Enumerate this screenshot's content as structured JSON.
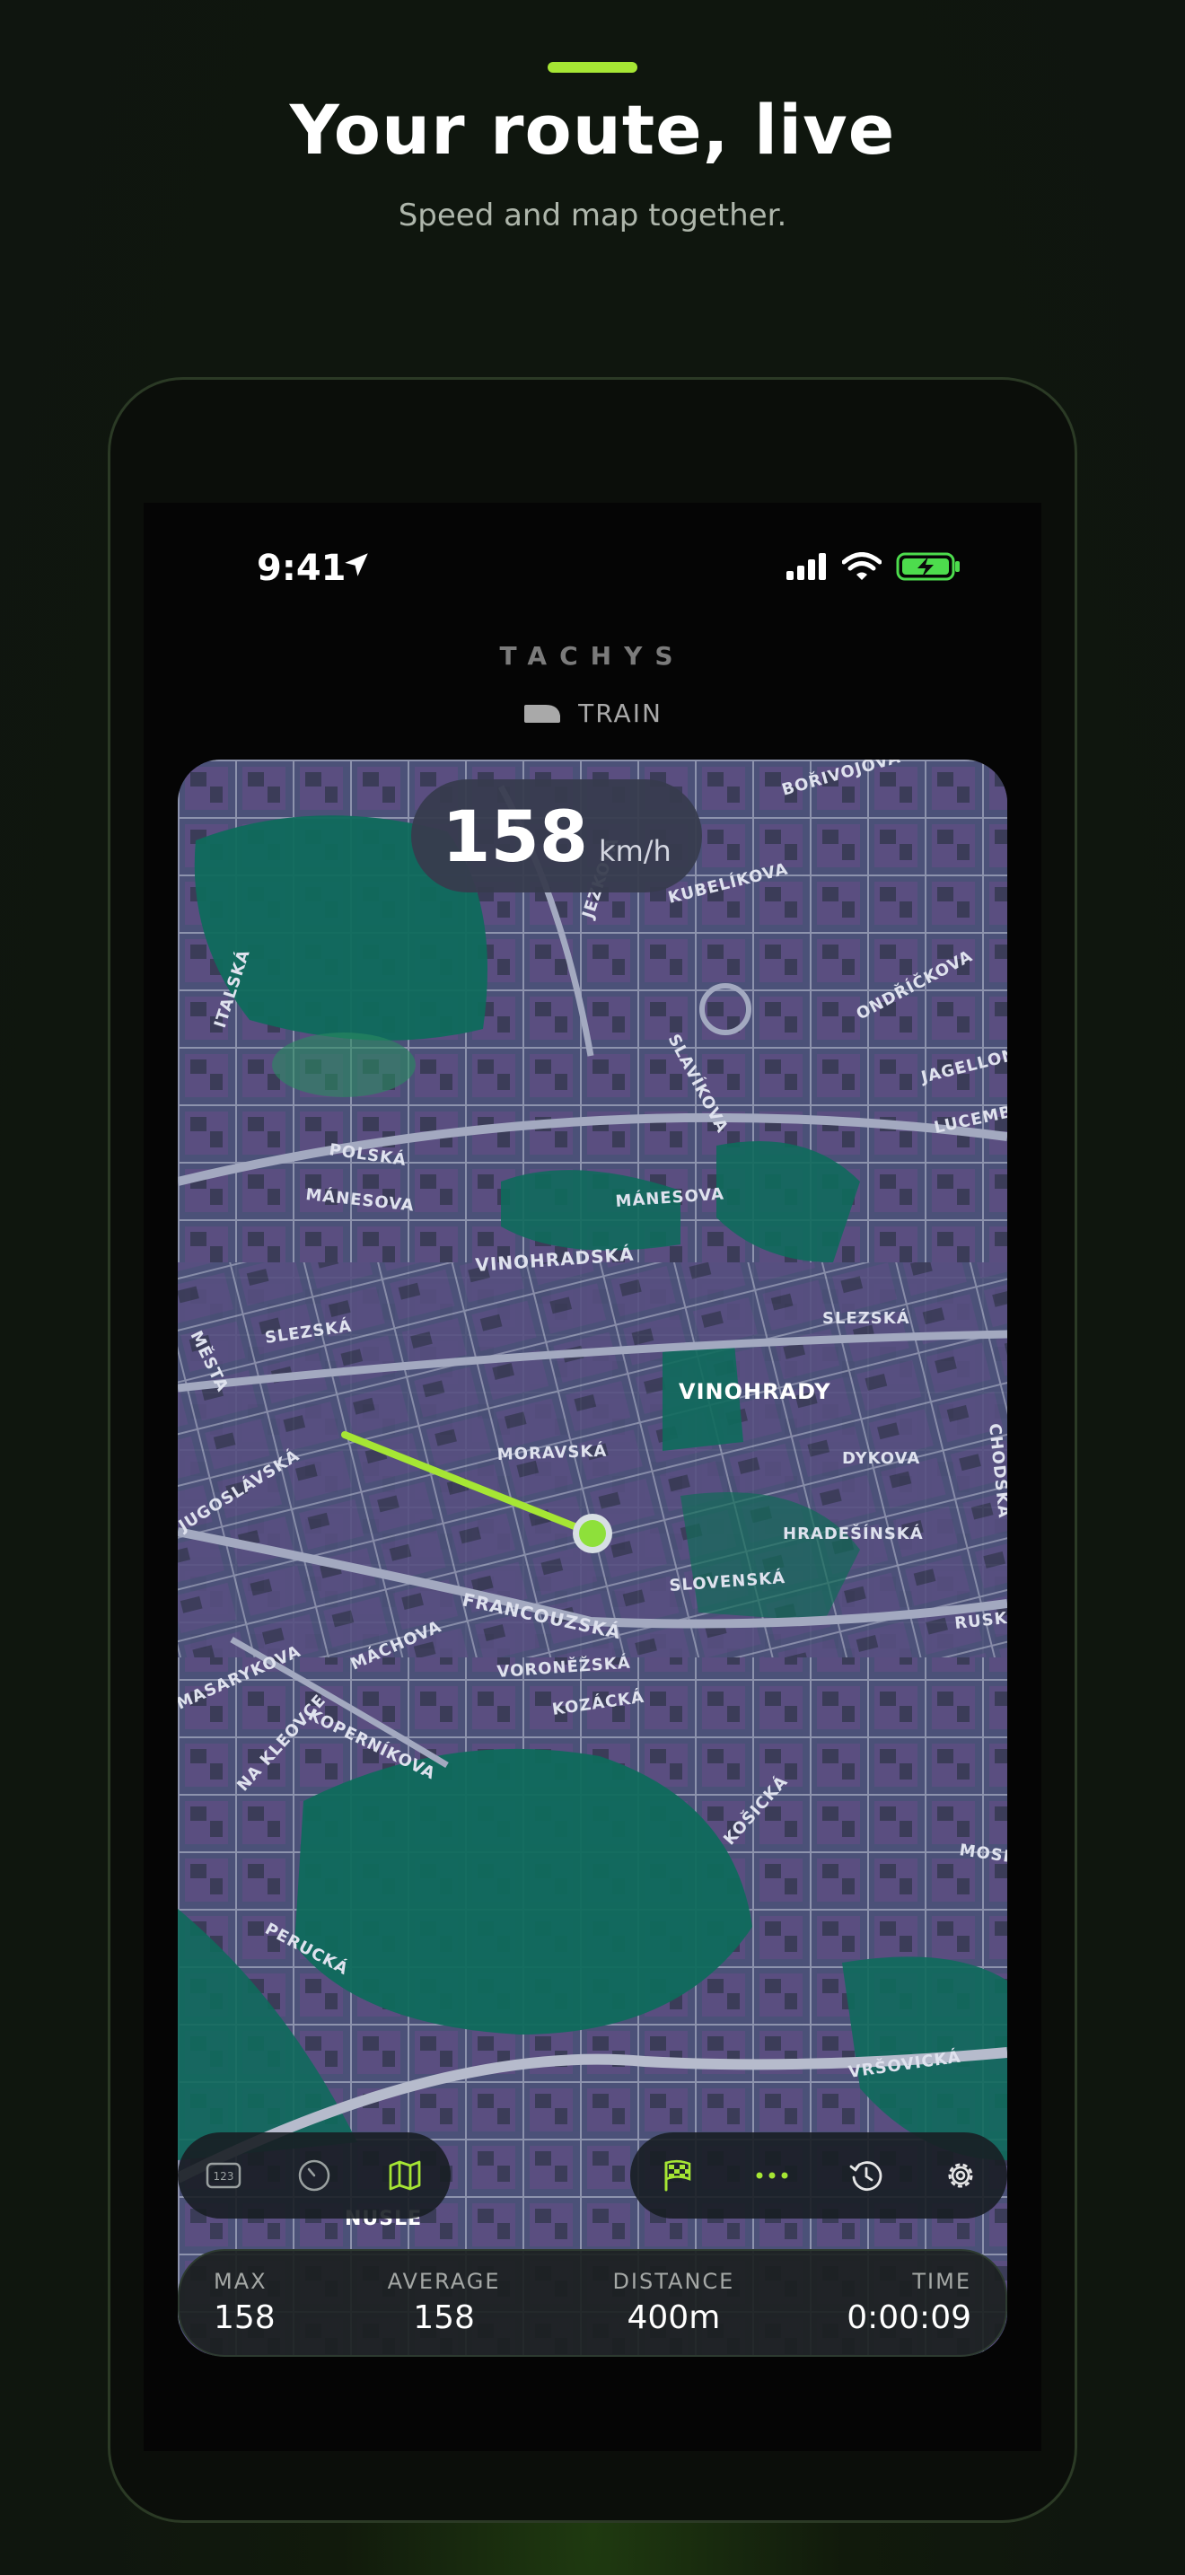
{
  "promo": {
    "headline": "Your route, live",
    "subheadline": "Speed and map together.",
    "accent_color": "#a6e634"
  },
  "status_bar": {
    "time": "9:41",
    "icons": [
      "location-arrow-icon",
      "cellular-signal-icon",
      "wifi-icon",
      "battery-charging-icon"
    ]
  },
  "app": {
    "title": "TACHYS",
    "mode_label": "TRAIN",
    "mode_icon": "train-icon"
  },
  "speed": {
    "value": "158",
    "unit": "km/h"
  },
  "map": {
    "street_labels": [
      "BOŘIVOJOVA",
      "KUBELÍKOVA",
      "ITALSKÁ",
      "SLAVÍKOVA",
      "ONDŘÍČKOVA",
      "JAGELLONSKÁ",
      "LUCEMBURSKÁ",
      "POLSKÁ",
      "MÁNESOVA",
      "MÁNESOVA",
      "VINOHRADSKÁ",
      "SLEZSKÁ",
      "SLEZSKÁ",
      "VINOHRADY",
      "MORAVSKÁ",
      "DYKOVA",
      "HRADEŠÍNSKÁ",
      "SLOVENSKÁ",
      "FRANCOUZSKÁ",
      "RUSKÁ",
      "VORONĚŽSKÁ",
      "KOZÁCKÁ",
      "MÁCHOVA",
      "MASARYKOVA",
      "KOPERNÍKOVA",
      "NA KLEOVCE",
      "KOŠICKÁ",
      "MOSKEVSKÁ",
      "PERUCKÁ",
      "VRŠOVICKÁ",
      "NUSLE",
      "JEZKOVA",
      "MĚSTA",
      "JUGOSLÁVSKÁ",
      "CHODSKÁ"
    ],
    "route_color": "#a6e634"
  },
  "toolbar_left": [
    "numeric-display-icon",
    "speedometer-icon",
    "map-icon"
  ],
  "toolbar_right": [
    "checkered-flag-icon",
    "more-dots-icon",
    "history-icon",
    "settings-gear-icon"
  ],
  "stats": {
    "max": {
      "label": "MAX",
      "value": "158"
    },
    "average": {
      "label": "AVERAGE",
      "value": "158"
    },
    "distance": {
      "label": "DISTANCE",
      "value": "400m"
    },
    "time": {
      "label": "TIME",
      "value": "0:00:09"
    }
  }
}
